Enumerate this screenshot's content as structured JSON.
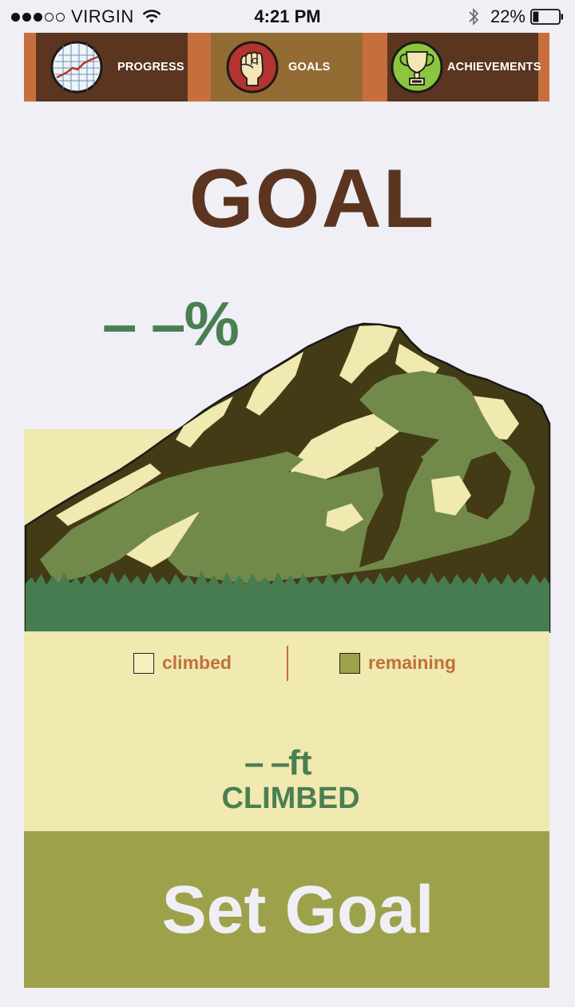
{
  "status_bar": {
    "carrier": "VIRGIN",
    "time": "4:21 PM",
    "battery_percent": "22%",
    "battery_level": 0.22,
    "signal_bars_filled": 3,
    "signal_bars_total": 5
  },
  "nav": {
    "tabs": [
      {
        "label": "PROGRESS",
        "icon": "chart-icon"
      },
      {
        "label": "GOALS",
        "icon": "fist-icon",
        "active": true
      },
      {
        "label": "ACHIEVEMENTS",
        "icon": "trophy-icon"
      }
    ]
  },
  "page": {
    "title": "GOAL",
    "percent_value": "– –",
    "percent_symbol": "%"
  },
  "legend": {
    "climbed_label": "climbed",
    "remaining_label": "remaining"
  },
  "stats": {
    "feet_value": "– –",
    "feet_unit": "ft",
    "climbed_caption": "CLIMBED"
  },
  "action": {
    "set_goal_label": "Set Goal"
  },
  "colors": {
    "brown": "#5b3520",
    "orange": "#c66f3d",
    "goals_tab": "#936c33",
    "green_text": "#4a7f52",
    "olive": "#9da24a",
    "cream": "#f0e9b0",
    "background": "#efeff5"
  }
}
